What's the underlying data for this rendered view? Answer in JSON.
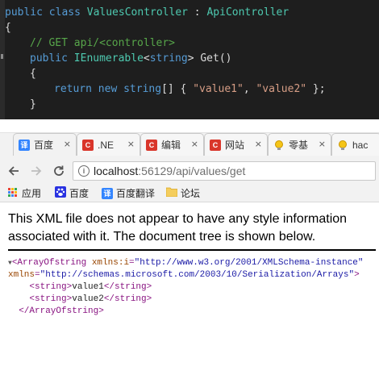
{
  "editor": {
    "line1": {
      "kw": "public class ",
      "type": "ValuesController",
      "sep": " : ",
      "base": "ApiController"
    },
    "line2": "{",
    "line3": "// GET api/<controller>",
    "line4": {
      "kw": "public ",
      "type": "IEnumerable",
      "lt": "<",
      "kw2": "string",
      "rest": "> Get()"
    },
    "line5": "{",
    "line6": {
      "kw": "return new string",
      "brackets": "[] { ",
      "v1": "\"value1\"",
      "comma": ", ",
      "v2": "\"value2\"",
      "end": " };"
    },
    "line7": "}"
  },
  "browser": {
    "tabs": [
      {
        "label": "百度",
        "icon": "baidu-translate-icon",
        "color": "#3385ff",
        "glyph": "译"
      },
      {
        "label": ".NE",
        "icon": "cnblogs-icon",
        "color": "#d9362b",
        "glyph": "C"
      },
      {
        "label": "编辑",
        "icon": "cnblogs-icon",
        "color": "#d9362b",
        "glyph": "C"
      },
      {
        "label": "网站",
        "icon": "cnblogs-icon",
        "color": "#d9362b",
        "glyph": "C"
      },
      {
        "label": "零基",
        "icon": "lightbulb-icon",
        "color": "#f0b400",
        "glyph": ""
      },
      {
        "label": "hac",
        "icon": "lightbulb-icon",
        "color": "#f0b400",
        "glyph": ""
      }
    ],
    "close_glyph": "×",
    "url": {
      "host": "localhost",
      "path": ":56129/api/values/get"
    },
    "bookmarks": {
      "apps": "应用",
      "baidu": "百度",
      "translate": "百度翻译",
      "forum": "论坛"
    }
  },
  "content": {
    "notice": "This XML file does not appear to have any style information associated with it. The document tree is shown below.",
    "xml": {
      "root_open": "<ArrayOfstring",
      "attr1_name": " xmlns:i",
      "attr1_eq": "=",
      "attr1_val": "\"http://www.w3.org/2001/XMLSchema-instance\"",
      "attr2_name": "xmlns",
      "attr2_eq": "=",
      "attr2_val": "\"http://schemas.microsoft.com/2003/10/Serialization/Arrays\"",
      "attr2_close": ">",
      "item1_open": "<string>",
      "item1_val": "value1",
      "item1_close": "</string>",
      "item2_open": "<string>",
      "item2_val": "value2",
      "item2_close": "</string>",
      "root_close": "</ArrayOfstring>"
    }
  },
  "colors": {
    "editor_bg": "#1e1e1e",
    "keyword": "#569cd6",
    "type": "#4ec9b0",
    "comment": "#57a64a",
    "string": "#d69d85",
    "xml_tag": "#881280",
    "xml_attr": "#994500",
    "xml_value": "#1a1aa6"
  }
}
